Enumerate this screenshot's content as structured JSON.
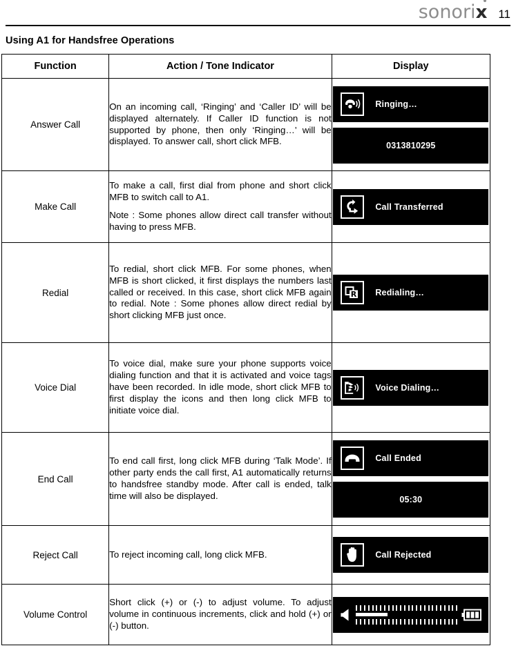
{
  "header": {
    "brand": "sonorix",
    "brand_x": "x",
    "page_number": "11"
  },
  "section_title": "Using A1 for Handsfree Operations",
  "table": {
    "columns": [
      "Function",
      "Action / Tone Indicator",
      "Display"
    ],
    "rows": [
      {
        "function": "Answer Call",
        "action_paragraphs": [
          "On an incoming call, ‘Ringing’ and ‘Caller ID’ will be displayed alternately. If Caller ID function is not supported by phone, then only ‘Ringing…’ will be displayed. To answer call, short click MFB."
        ],
        "displays": [
          {
            "icon": "ringing-phone-icon",
            "label": "Ringing…",
            "style": "icon-label"
          },
          {
            "icon": "",
            "label": "0313810295",
            "style": "centered"
          }
        ]
      },
      {
        "function": "Make Call",
        "action_paragraphs": [
          "To make a call, first dial from phone and short click MFB to switch call to A1.",
          "Note : Some phones allow direct call transfer without having to press MFB."
        ],
        "displays": [
          {
            "icon": "transfer-arrow-icon",
            "label": "Call Transferred",
            "style": "icon-label"
          }
        ]
      },
      {
        "function": "Redial",
        "action_paragraphs": [
          "To redial, short click MFB. For some phones, when MFB is short clicked, it first displays the numbers last called or received. In this case, short click MFB again to redial. Note : Some phones allow direct redial by short clicking MFB just once."
        ],
        "displays": [
          {
            "icon": "redial-r-icon",
            "label": "Redialing…",
            "style": "icon-label"
          }
        ]
      },
      {
        "function": "Voice Dial",
        "action_paragraphs": [
          "To voice dial, make sure your phone supports voice dialing function and that it is activated and voice tags have been recorded. In idle mode, short click MFB to first display the icons and then long click MFB to initiate voice dial."
        ],
        "displays": [
          {
            "icon": "voice-speech-icon",
            "label": "Voice Dialing…",
            "style": "icon-label"
          }
        ]
      },
      {
        "function": "End Call",
        "action_paragraphs": [
          "To end call first, long click MFB during ‘Talk Mode’. If other party ends the call first, A1 automatically returns to handsfree standby mode. After call is ended, talk time will also be displayed."
        ],
        "displays": [
          {
            "icon": "handset-down-icon",
            "label": "Call Ended",
            "style": "icon-label"
          },
          {
            "icon": "",
            "label": "05:30",
            "style": "centered"
          }
        ]
      },
      {
        "function": "Reject Call",
        "action_paragraphs": [
          "To reject incoming call, long click MFB."
        ],
        "displays": [
          {
            "icon": "hand-stop-icon",
            "label": "Call Rejected",
            "style": "icon-label"
          }
        ]
      },
      {
        "function": "Volume Control",
        "action_paragraphs": [
          "Short click (+) or (-) to adjust volume. To adjust volume in continuous increments, click and hold (+) or (-) button."
        ],
        "displays": [
          {
            "icon": "speaker-icon",
            "label": "",
            "style": "volume",
            "volume_percent": 31,
            "tick_count": 26,
            "battery_bars": 3
          }
        ]
      }
    ]
  },
  "colors": {
    "lcd_background": "#000000",
    "lcd_foreground": "#ffffff",
    "brand_gray": "#8d8d8d",
    "rule": "#000000"
  }
}
